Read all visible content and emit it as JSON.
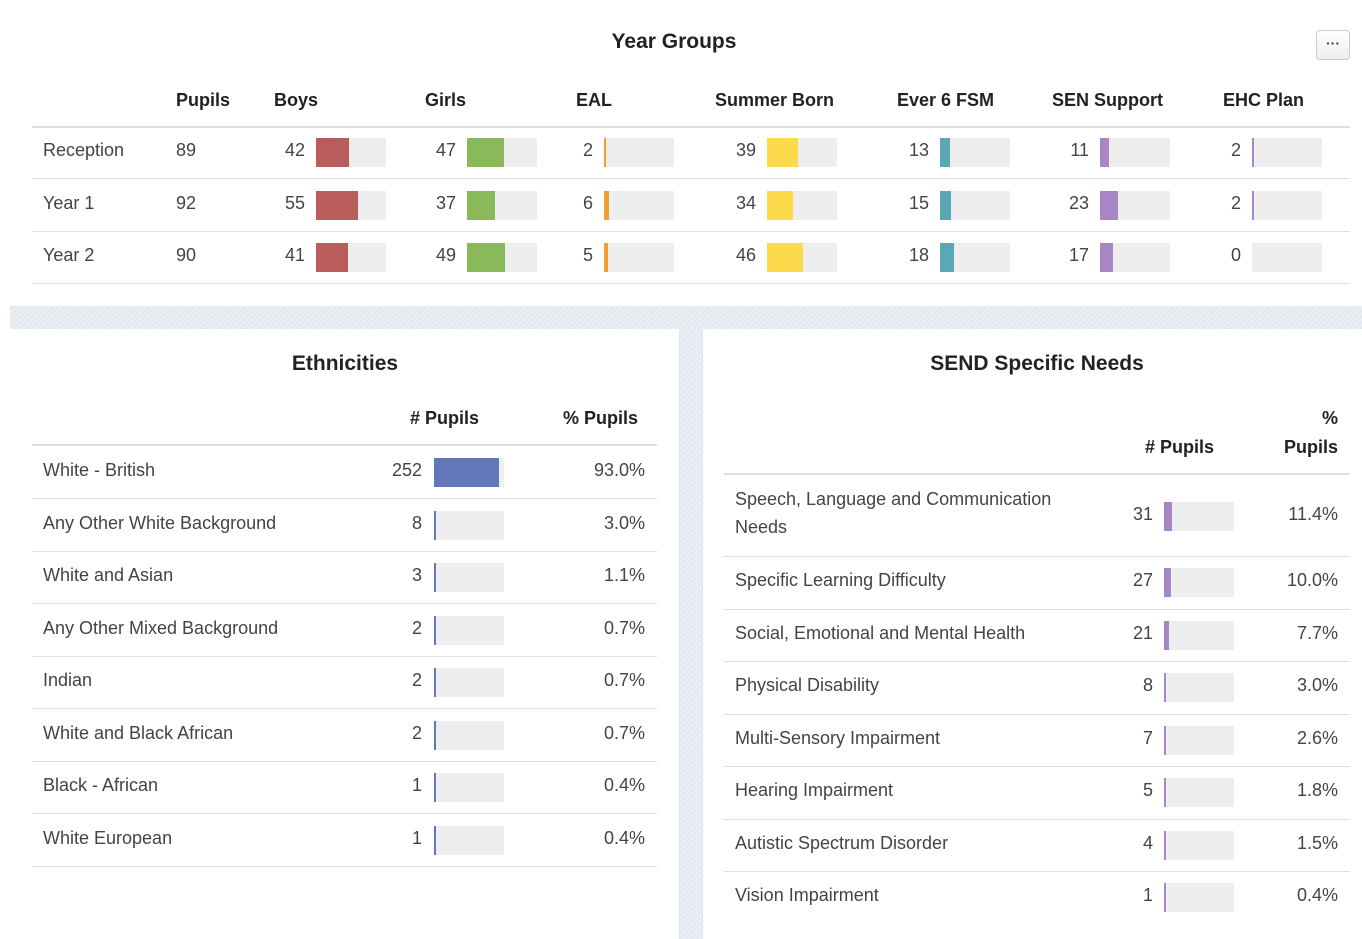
{
  "year_groups": {
    "title": "Year Groups",
    "menu_label": "···",
    "columns": [
      "Pupils",
      "Boys",
      "Girls",
      "EAL",
      "Summer Born",
      "Ever 6 FSM",
      "SEN Support",
      "EHC Plan"
    ],
    "colors": {
      "boys": "#b85c5c",
      "girls": "#8ab95a",
      "eal": "#f0a030",
      "summer_born": "#fdd94c",
      "fsm": "#5ba8b5",
      "sen": "#a887c7",
      "ehc": "#a887c7"
    },
    "rows": [
      {
        "label": "Reception",
        "pupils": "89",
        "boys": "42",
        "girls": "47",
        "eal": "2",
        "summer_born": "39",
        "fsm": "13",
        "sen": "11",
        "ehc": "2"
      },
      {
        "label": "Year 1",
        "pupils": "92",
        "boys": "55",
        "girls": "37",
        "eal": "6",
        "summer_born": "34",
        "fsm": "15",
        "sen": "23",
        "ehc": "2"
      },
      {
        "label": "Year 2",
        "pupils": "90",
        "boys": "41",
        "girls": "49",
        "eal": "5",
        "summer_born": "46",
        "fsm": "18",
        "sen": "17",
        "ehc": "0"
      }
    ]
  },
  "ethnicities": {
    "title": "Ethnicities",
    "col_count": "# Pupils",
    "col_pct": "% Pupils",
    "bar_color": "#6177b8",
    "rows": [
      {
        "label": "White - British",
        "count": "252",
        "pct": "93.0%"
      },
      {
        "label": "Any Other White Background",
        "count": "8",
        "pct": "3.0%"
      },
      {
        "label": "White and Asian",
        "count": "3",
        "pct": "1.1%"
      },
      {
        "label": "Any Other Mixed Background",
        "count": "2",
        "pct": "0.7%"
      },
      {
        "label": "Indian",
        "count": "2",
        "pct": "0.7%"
      },
      {
        "label": "White and Black African",
        "count": "2",
        "pct": "0.7%"
      },
      {
        "label": "Black - African",
        "count": "1",
        "pct": "0.4%"
      },
      {
        "label": "White European",
        "count": "1",
        "pct": "0.4%"
      }
    ]
  },
  "send": {
    "title": "SEND Specific Needs",
    "col_count": "# Pupils",
    "col_pct_line1": "%",
    "col_pct_line2": "Pupils",
    "bar_color": "#a887c7",
    "rows": [
      {
        "label_line1": "Speech, Language and Communication",
        "label_line2": "Needs",
        "count": "31",
        "pct": "11.4%"
      },
      {
        "label_line1": "Specific Learning Difficulty",
        "label_line2": "",
        "count": "27",
        "pct": "10.0%"
      },
      {
        "label_line1": "Social, Emotional and Mental Health",
        "label_line2": "",
        "count": "21",
        "pct": "7.7%"
      },
      {
        "label_line1": "Physical Disability",
        "label_line2": "",
        "count": "8",
        "pct": "3.0%"
      },
      {
        "label_line1": "Multi-Sensory Impairment",
        "label_line2": "",
        "count": "7",
        "pct": "2.6%"
      },
      {
        "label_line1": "Hearing Impairment",
        "label_line2": "",
        "count": "5",
        "pct": "1.8%"
      },
      {
        "label_line1": "Autistic Spectrum Disorder",
        "label_line2": "",
        "count": "4",
        "pct": "1.5%"
      },
      {
        "label_line1": "Vision Impairment",
        "label_line2": "",
        "count": "1",
        "pct": "0.4%"
      }
    ]
  }
}
